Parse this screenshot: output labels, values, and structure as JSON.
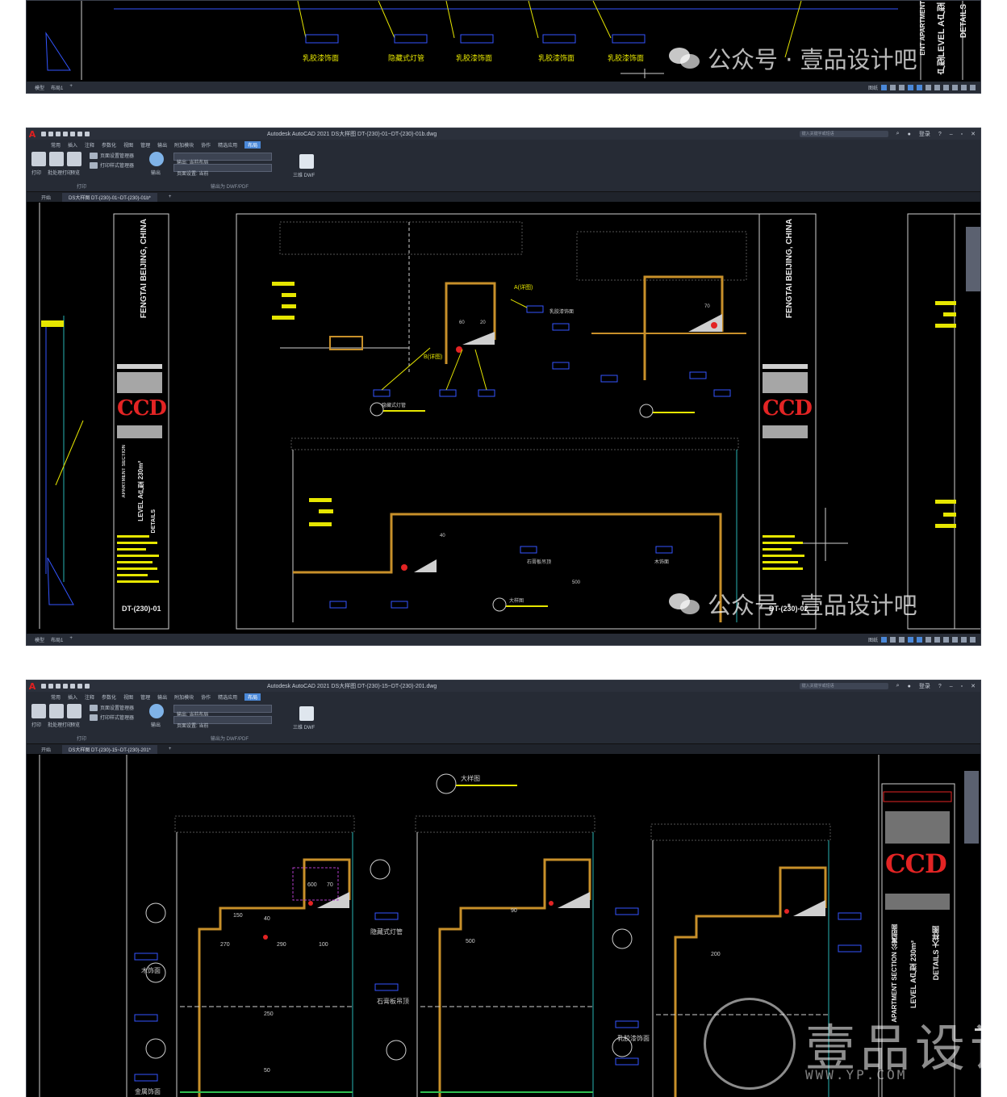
{
  "shot1": {
    "labels": [
      "乳胶漆饰面",
      "隐藏式灯管",
      "乳胶漆饰面",
      "乳胶漆饰面",
      "乳胶漆饰面"
    ],
    "side_title": "ENT APARTMENT",
    "side_title2": "户型LEVEL A户型",
    "side_details": "DETAILS",
    "layout_tabs": [
      "模型",
      "布局1"
    ],
    "watermark": "公众号 · 壹品设计吧"
  },
  "app": {
    "logo": "A",
    "title2": "Autodesk AutoCAD 2021   DS大样图 DT-(230)-01~DT-(230)-01b.dwg",
    "title3": "Autodesk AutoCAD 2021   DS大样图 DT-(230)-15~DT-(230)-201.dwg",
    "search_placeholder": "键入关键字或短语",
    "login": "登录",
    "menu": [
      "常用",
      "插入",
      "注释",
      "参数化",
      "视图",
      "管理",
      "输出",
      "附加模块",
      "协作",
      "精选应用",
      "布局"
    ],
    "active_menu": "布局",
    "ribbon": {
      "print": "打印",
      "plot_preview": "批处理打印",
      "preview": "预览",
      "page_setup": "页面设置管理器",
      "plot_style": "打印样式管理器",
      "export": "输出",
      "combo1": "输出: 当前布局",
      "combo2": "页面设置: 当前",
      "dwf": "三维 DWF",
      "panel_print": "打印",
      "panel_export": "输出为 DWF/PDF"
    },
    "start_tab": "开始",
    "doc_tab2": "DS大样图 DT-(230)-01~DT-(230)-01b*",
    "doc_tab3": "DS大样图 DT-(230)-15~DT-(230)-201*",
    "layout_tabs": [
      "模型",
      "布局1"
    ],
    "status_model": "图纸"
  },
  "shot2": {
    "title_block_left": {
      "project": "FENGTAI BEIJING, CHINA",
      "ccd": "CCD",
      "section": "APARTMENT SECTION",
      "level": "LEVEL A户型 230m²",
      "details": "DETAILS",
      "sheet": "DT-(230)-01"
    },
    "title_block_right": {
      "project": "FENGTAI BEIJING, CHINA",
      "ccd": "CCD",
      "sheet": "DT-(230)-02"
    },
    "detail_labels": [
      "A(详图)",
      "B(详图)",
      "乳胶漆饰面",
      "隐藏式灯管",
      "石膏板吊顶",
      "木饰面",
      "大样图"
    ],
    "dims": [
      "60",
      "20",
      "70",
      "40",
      "500"
    ],
    "watermark": "公众号 · 壹品设计吧"
  },
  "shot3": {
    "title_tag": "大样图",
    "detail_labels": [
      "隐藏式灯管",
      "木饰面",
      "石膏板吊顶",
      "金属饰面",
      "乳胶漆饰面"
    ],
    "dims": [
      "600",
      "70",
      "150",
      "270",
      "290",
      "100",
      "500",
      "200",
      "250",
      "50",
      "90",
      "40"
    ],
    "title_block": {
      "ccd": "CCD",
      "section": "APARTMENT SECTION 公寓剖面",
      "level": "LEVEL A户型 230m²",
      "details": "DETAILS 大样图"
    },
    "big_watermark": "壹品设计",
    "big_watermark_sub": "WWW.YP.COM"
  },
  "colors": {
    "cad_bg": "#000000",
    "ui_dark": "#262b35",
    "accent": "#4a88d8",
    "line_yellow": "#e6e600",
    "line_blue": "#3355ff",
    "line_orange": "#c8902a",
    "line_cyan": "#27b4b4",
    "ccd_red": "#e32424"
  }
}
